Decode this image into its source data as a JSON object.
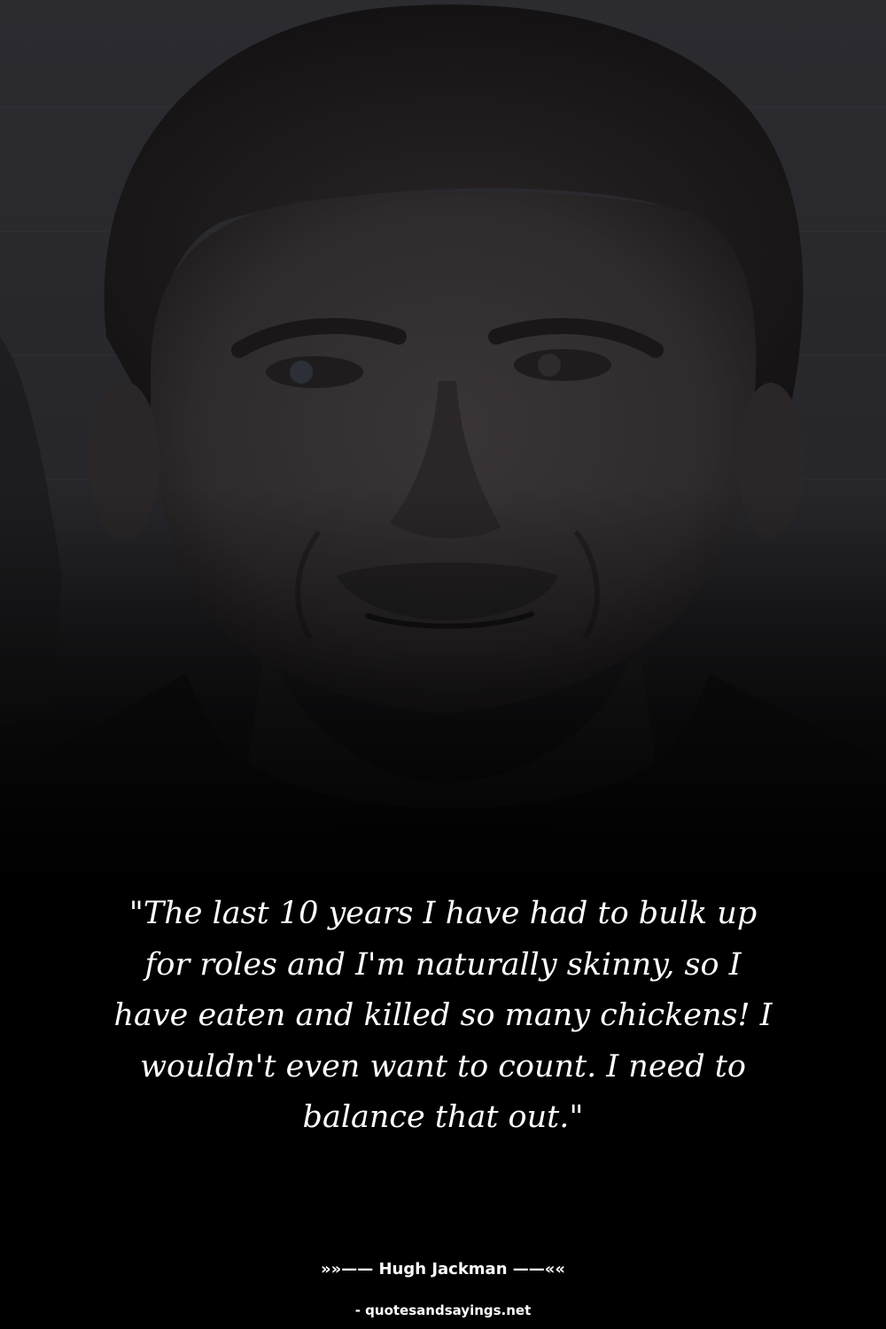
{
  "quote": {
    "text": "\"The last 10 years I have had to bulk up for roles and I'm naturally skinny, so I have eaten and killed so many chickens! I wouldn't even want to count. I need to balance that out.\"",
    "author_line": "»»—— Hugh Jackman ——««",
    "source": "- quotesandsayings.net"
  },
  "colors": {
    "background": "#000000",
    "text": "#ffffff",
    "photo_tone": "#2e2e31"
  },
  "image": {
    "subject": "portrait-photo"
  }
}
